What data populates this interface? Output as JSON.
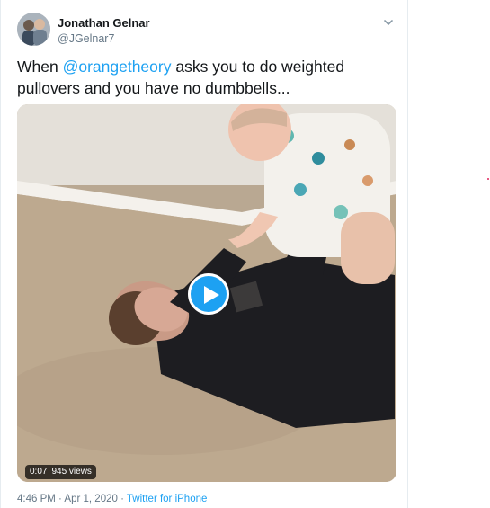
{
  "tweet": {
    "author": {
      "display_name": "Jonathan Gelnar",
      "handle": "@JGelnar7"
    },
    "text_before": "When ",
    "mention": "@orangetheory",
    "text_after": " asks you to do weighted pullovers and you have no dumbbells...",
    "media": {
      "type": "video",
      "duration": "0:07",
      "views": "945 views"
    },
    "meta": {
      "time": "4:46 PM",
      "separator": " · ",
      "date": "Apr 1, 2020",
      "source": "Twitter for iPhone"
    }
  },
  "colors": {
    "accent": "#1da1f2",
    "text": "#14171a",
    "secondary": "#657786"
  },
  "icons": {
    "menu": "chevron-down-icon",
    "play": "play-icon"
  }
}
